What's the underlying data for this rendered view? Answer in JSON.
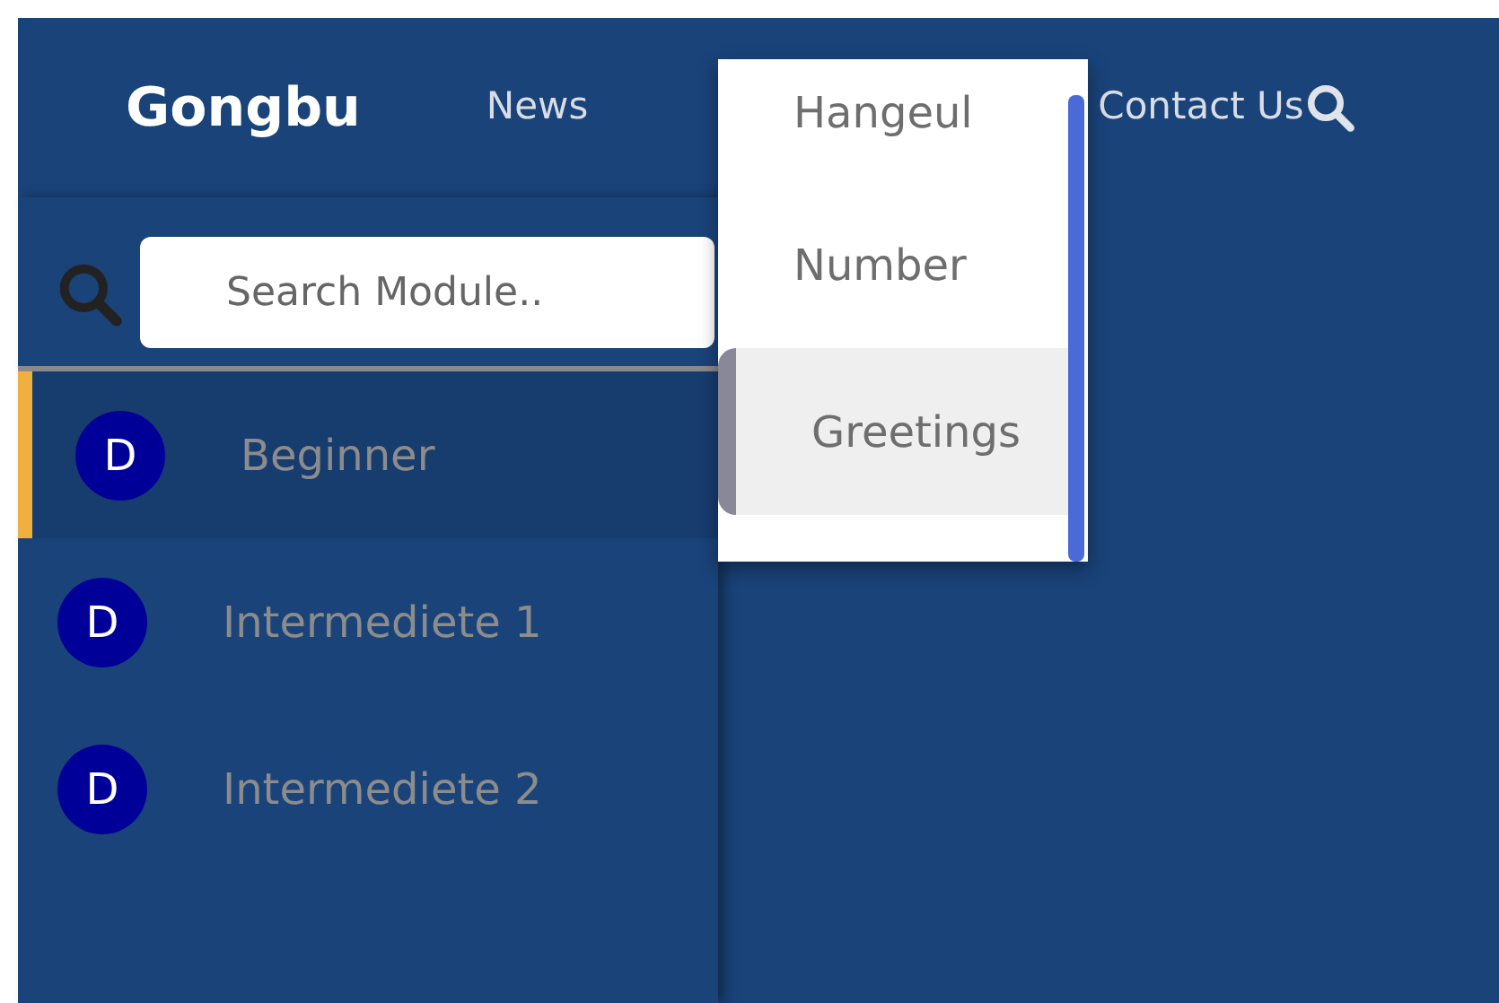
{
  "navbar": {
    "brand": "Gongbu",
    "links": [
      {
        "label": "News"
      },
      {
        "label": "Contact Us"
      }
    ]
  },
  "sidebar": {
    "search": {
      "placeholder": "Search Module.."
    },
    "items": [
      {
        "avatar": "D",
        "label": "Beginner",
        "selected": true
      },
      {
        "avatar": "D",
        "label": "Intermediete 1",
        "selected": false
      },
      {
        "avatar": "D",
        "label": "Intermediete 2",
        "selected": false
      }
    ]
  },
  "dropdown": {
    "items": [
      {
        "label": "Hangeul",
        "selected": false
      },
      {
        "label": "Number",
        "selected": false
      },
      {
        "label": "Greetings",
        "selected": true
      }
    ]
  }
}
